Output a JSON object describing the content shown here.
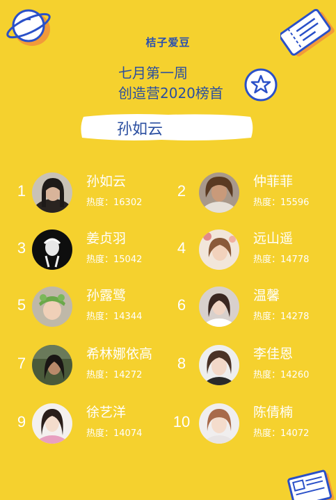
{
  "brand": "桔子爱豆",
  "title_line1": "七月第一周",
  "title_line2": "创造营2020榜首",
  "top_name": "孙如云",
  "heat_label": "热度：",
  "icons": {
    "top_left": "planet-icon",
    "top_right": "ticket-icon",
    "title_badge": "star-badge-icon",
    "bottom_right": "newspaper-icon"
  },
  "colors": {
    "background": "#f5d12e",
    "accent_blue": "#2a4ea0",
    "text_white": "#ffffff"
  },
  "rankings": [
    {
      "rank": "1",
      "name": "孙如云",
      "heat": "16302"
    },
    {
      "rank": "2",
      "name": "仲菲菲",
      "heat": "15596"
    },
    {
      "rank": "3",
      "name": "姜贞羽",
      "heat": "15042"
    },
    {
      "rank": "4",
      "name": "远山遥",
      "heat": "14778"
    },
    {
      "rank": "5",
      "name": "孙露鹭",
      "heat": "14344"
    },
    {
      "rank": "6",
      "name": "温馨",
      "heat": "14278"
    },
    {
      "rank": "7",
      "name": "希林娜依高",
      "heat": "14272"
    },
    {
      "rank": "8",
      "name": "李佳恩",
      "heat": "14260"
    },
    {
      "rank": "9",
      "name": "徐艺洋",
      "heat": "14074"
    },
    {
      "rank": "10",
      "name": "陈倩楠",
      "heat": "14072"
    }
  ]
}
